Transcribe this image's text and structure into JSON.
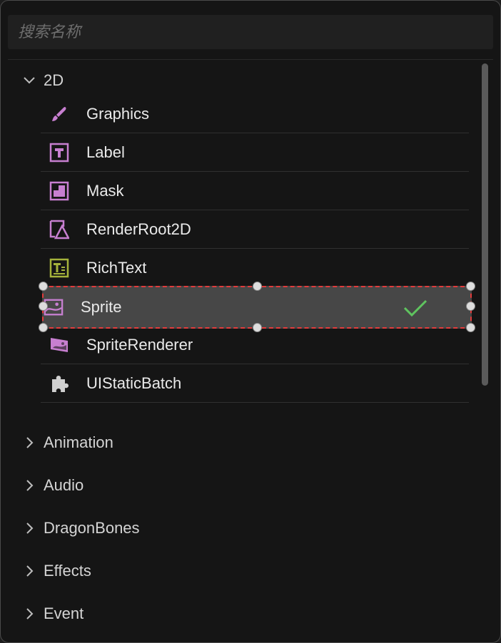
{
  "search": {
    "placeholder": "搜索名称",
    "value": ""
  },
  "groups": [
    {
      "label": "2D",
      "expanded": true,
      "items": [
        {
          "label": "Graphics",
          "icon": "brush-icon"
        },
        {
          "label": "Label",
          "icon": "text-t-icon"
        },
        {
          "label": "Mask",
          "icon": "mask-icon"
        },
        {
          "label": "RenderRoot2D",
          "icon": "render-root-icon"
        },
        {
          "label": "RichText",
          "icon": "rich-text-icon"
        },
        {
          "label": "Sprite",
          "icon": "sprite-image-icon",
          "selected": true
        },
        {
          "label": "SpriteRenderer",
          "icon": "sprite-renderer-icon"
        },
        {
          "label": "UIStaticBatch",
          "icon": "puzzle-icon"
        }
      ]
    },
    {
      "label": "Animation",
      "expanded": false
    },
    {
      "label": "Audio",
      "expanded": false
    },
    {
      "label": "DragonBones",
      "expanded": false
    },
    {
      "label": "Effects",
      "expanded": false
    },
    {
      "label": "Event",
      "expanded": false
    }
  ],
  "colors": {
    "icon_purple": "#c77fd0",
    "icon_olive": "#a5b33b",
    "icon_grey": "#d0d0d0",
    "check_green": "#5fc45f",
    "selection_border": "#e23b3b"
  }
}
